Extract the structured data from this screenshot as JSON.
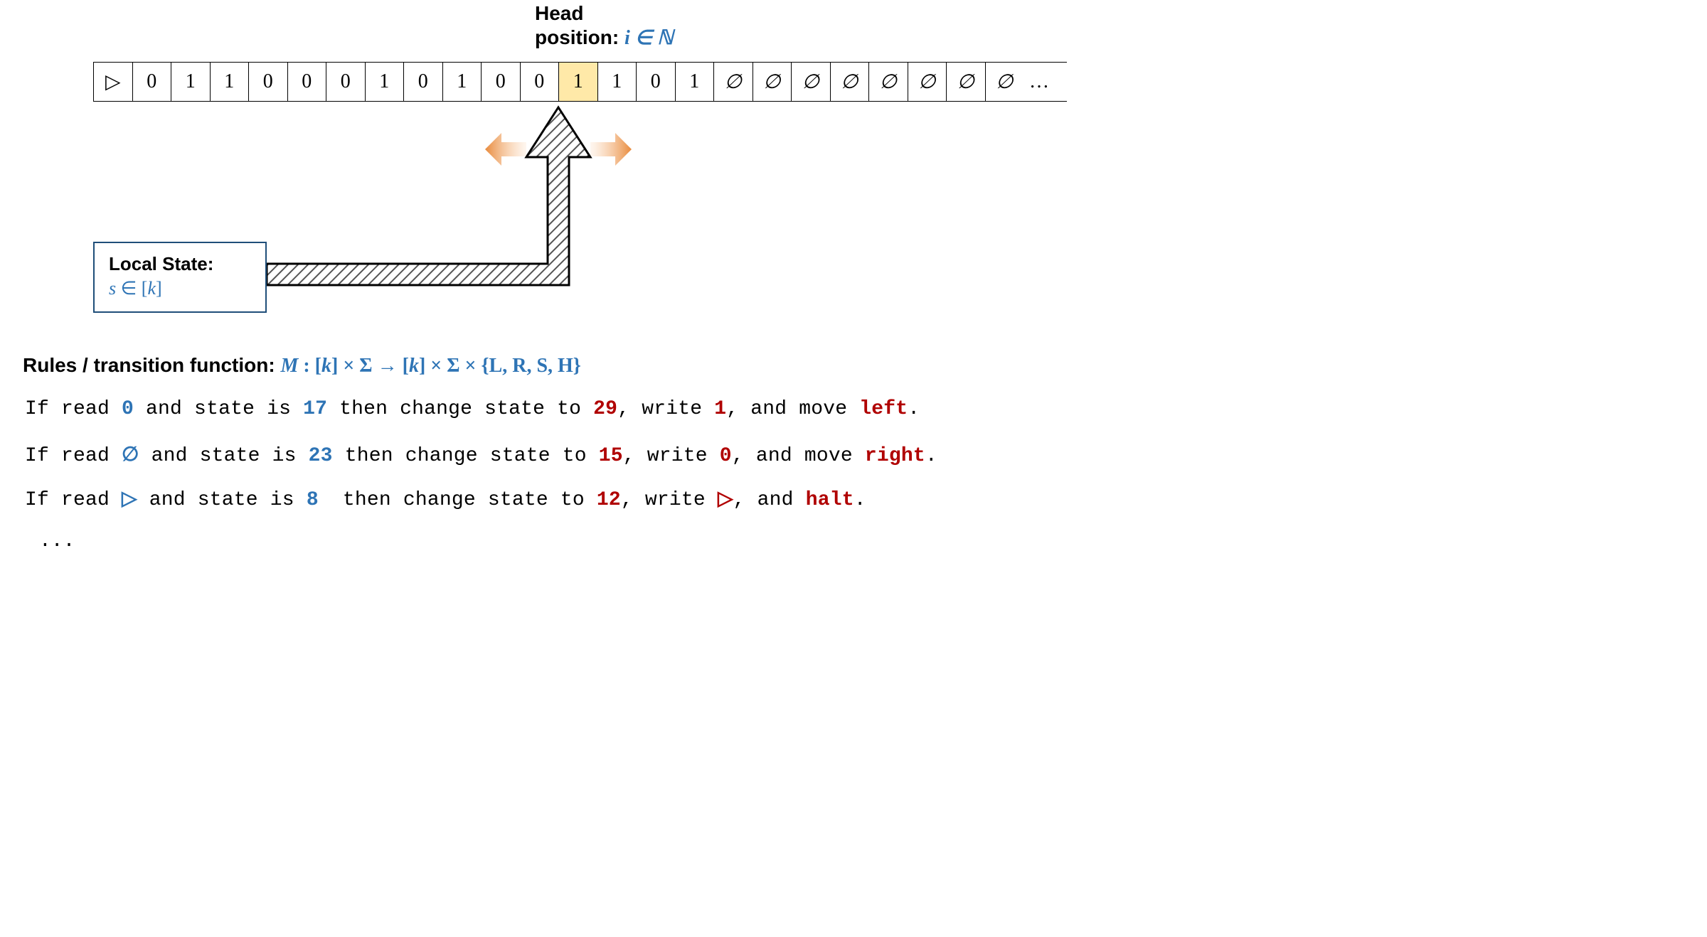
{
  "head": {
    "line1": "Head",
    "line2_prefix": "position: ",
    "line2_math": "i ∈ ℕ"
  },
  "tape": {
    "cells": [
      "▷",
      "0",
      "1",
      "1",
      "0",
      "0",
      "0",
      "1",
      "0",
      "1",
      "0",
      "0",
      "1",
      "1",
      "0",
      "1",
      "∅",
      "∅",
      "∅",
      "∅",
      "∅",
      "∅",
      "∅",
      "∅"
    ],
    "highlight_index": 12,
    "end": "…"
  },
  "state_box": {
    "title": "Local State:",
    "math": "s ∈ [k]"
  },
  "rules": {
    "heading_prefix": "Rules / transition function: ",
    "heading_math": "M : [k] × Σ → [k] × Σ × {L, R, S, H}",
    "r1": {
      "t0": "If read ",
      "sym": "0",
      "t1": " and state is ",
      "st": "17",
      "t2": " then change state to ",
      "ns": "29",
      "t3": ", write ",
      "wr": "1",
      "t4": ", and move ",
      "mv": "left",
      "t5": "."
    },
    "r2": {
      "t0": "If read ",
      "sym": "∅",
      "t1": " and state is ",
      "st": "23",
      "t2": " then change state to ",
      "ns": "15",
      "t3": ", write ",
      "wr": "0",
      "t4": ", and move ",
      "mv": "right",
      "t5": "."
    },
    "r3": {
      "t0": "If read ",
      "sym": "▷",
      "t1": " and state is ",
      "st": "8 ",
      "t2": " then change state to ",
      "ns": "12",
      "t3": ", write ",
      "wr": "▷",
      "t4": ", and ",
      "mv": "halt",
      "t5": "."
    },
    "dots": "..."
  }
}
